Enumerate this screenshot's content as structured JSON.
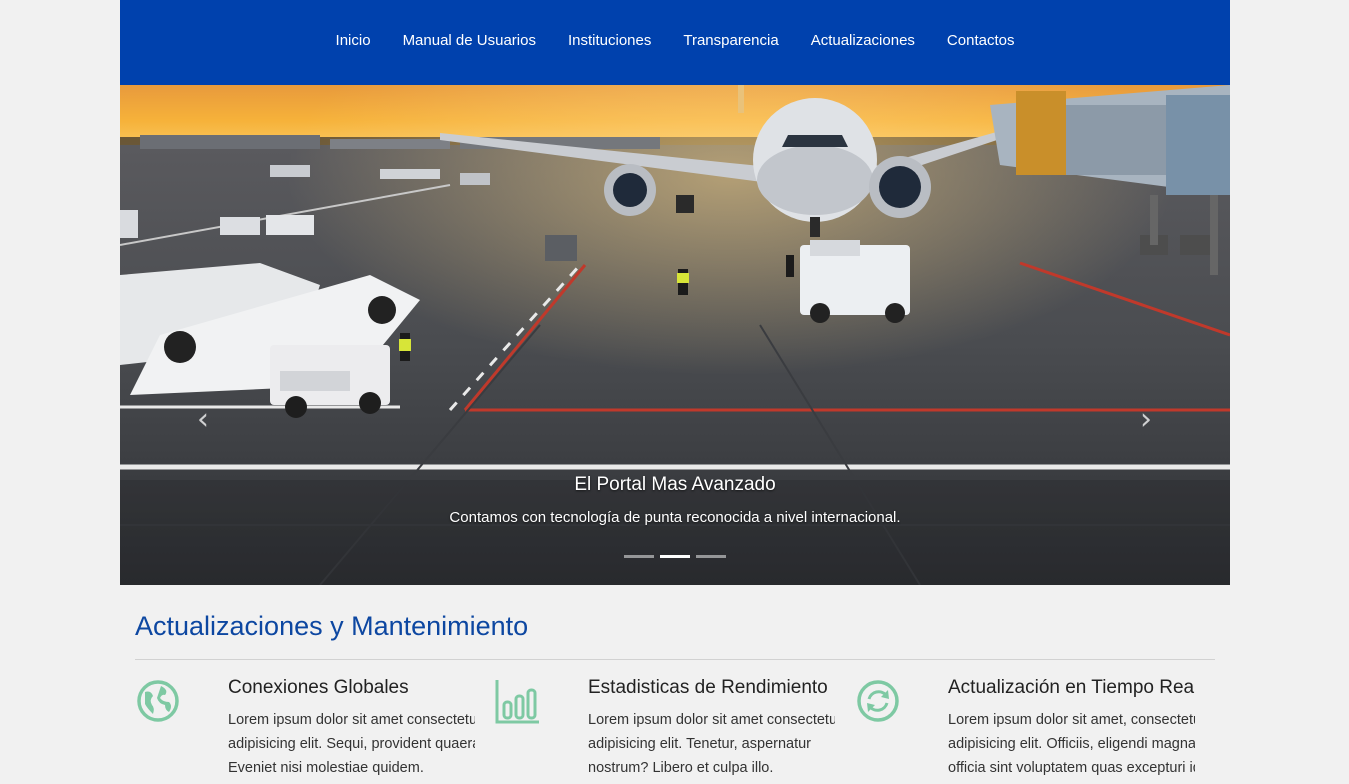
{
  "nav": {
    "items": [
      {
        "label": "Inicio"
      },
      {
        "label": "Manual de Usuarios"
      },
      {
        "label": "Instituciones"
      },
      {
        "label": "Transparencia"
      },
      {
        "label": "Actualizaciones"
      },
      {
        "label": "Contactos"
      }
    ]
  },
  "carousel": {
    "caption_title": "El Portal Mas Avanzado",
    "caption_text": "Contamos con tecnología de punta reconocida a nivel internacional.",
    "prev_icon": "chevron-left-icon",
    "next_icon": "chevron-right-icon",
    "slide_count": 3,
    "active_slide": 2
  },
  "section": {
    "title": "Actualizaciones y Mantenimiento"
  },
  "features": [
    {
      "icon": "globe-icon",
      "title": "Conexiones Globales",
      "text": "Lorem ipsum dolor sit amet consectetur, adipisicing elit. Sequi, provident quaerat. Eveniet nisi molestiae quidem."
    },
    {
      "icon": "bar-chart-icon",
      "title": "Estadisticas de Rendimiento",
      "text": "Lorem ipsum dolor sit amet consectetur adipisicing elit. Tenetur, aspernatur nostrum? Libero et culpa illo."
    },
    {
      "icon": "sync-icon",
      "title": "Actualización en Tiempo Real",
      "text": "Lorem ipsum dolor sit amet, consectetur adipisicing elit. Officiis, eligendi magnam officia sint voluptatem quas excepturi id."
    }
  ],
  "colors": {
    "nav_bg": "#0041ad",
    "heading": "#0d47a1",
    "icon": "#7ec9a3",
    "page_bg": "#f1f1f1"
  }
}
